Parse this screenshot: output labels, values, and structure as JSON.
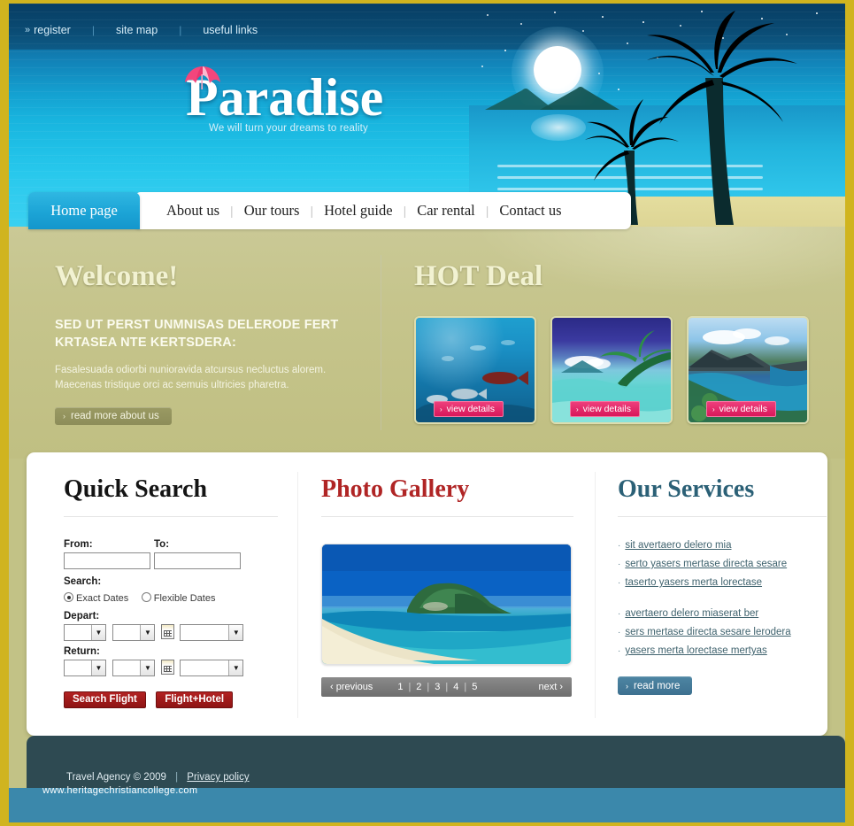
{
  "brand": {
    "name": "Paradise",
    "tagline": "We will turn your dreams to reality",
    "umbrella_icon": "umbrella-icon",
    "accent_gold": "#d0b41f",
    "accent_olive": "#c2c286",
    "accent_blue": "#1ca4d6",
    "accent_pink": "#d9175a",
    "accent_red": "#8e1414",
    "accent_teal": "#3d7190",
    "footer_dark": "#2e4a52"
  },
  "toplinks": {
    "chevron": "»",
    "items": [
      {
        "label": "register"
      },
      {
        "label": "site map"
      },
      {
        "label": "useful links"
      }
    ],
    "separator": "|"
  },
  "nav": {
    "active": {
      "label": "Home page"
    },
    "items": [
      {
        "label": "About us"
      },
      {
        "label": "Our tours"
      },
      {
        "label": "Hotel guide"
      },
      {
        "label": "Car rental"
      },
      {
        "label": "Contact us"
      }
    ],
    "separator": "|"
  },
  "welcome": {
    "heading": "Welcome!",
    "subheading": "SED UT PERST UNMNISAS DELERODE FERT KRTASEA NTE KERTSDERA:",
    "body": "Fasalesuada odiorbi nunioravida atcursus necluctus alorem. Maecenas tristique orci ac semuis ultricies pharetra.",
    "button": "read more about us",
    "button_arrow": "›"
  },
  "hotdeal": {
    "heading": "HOT Deal",
    "button_arrow": "›",
    "deals": [
      {
        "image": "underwater-reef-photo",
        "button": "view details"
      },
      {
        "image": "palm-tree-lagoon-photo",
        "button": "view details"
      },
      {
        "image": "coastline-bay-photo",
        "button": "view details"
      }
    ]
  },
  "quick_search": {
    "heading": "Quick Search",
    "from_label": "From:",
    "from_value": "",
    "from_placeholder": "",
    "to_label": "To:",
    "to_value": "",
    "to_placeholder": "",
    "search_label": "Search:",
    "radio_exact": "Exact Dates",
    "radio_flexible": "Flexible Dates",
    "radio_selected": "Exact Dates",
    "depart_label": "Depart:",
    "return_label": "Return:",
    "depart": {
      "day": "",
      "month": "",
      "year": ""
    },
    "return": {
      "day": "",
      "month": "",
      "year": ""
    },
    "calendar_icon": "calendar-icon",
    "dropdown_icon": "chevron-down-icon",
    "buttons": [
      {
        "label": "Search Flight"
      },
      {
        "label": "Flight+Hotel"
      }
    ]
  },
  "gallery": {
    "heading": "Photo Gallery",
    "image": "island-beach-photo",
    "pager": {
      "previous": "previous",
      "previous_arrow": "‹",
      "next": "next",
      "next_arrow": "›",
      "pages": [
        "1",
        "2",
        "3",
        "4",
        "5"
      ],
      "current": "1",
      "separator": "|"
    }
  },
  "services": {
    "heading": "Our Services",
    "bullet": "·",
    "group_one": [
      {
        "label": "sit avertaero delero mia"
      },
      {
        "label": "serto yasers mertase directa sesare"
      },
      {
        "label": "taserto yasers merta lorectase"
      }
    ],
    "group_two": [
      {
        "label": "avertaero delero miaserat ber"
      },
      {
        "label": "sers mertase directa sesare lerodera"
      },
      {
        "label": "yasers merta lorectase mertyas"
      }
    ],
    "button": "read more",
    "button_arrow": "›"
  },
  "footer": {
    "copyright": "Travel Agency © 2009",
    "separator": "|",
    "privacy": "Privacy policy",
    "url": "www.heritagechristiancollege.com"
  }
}
